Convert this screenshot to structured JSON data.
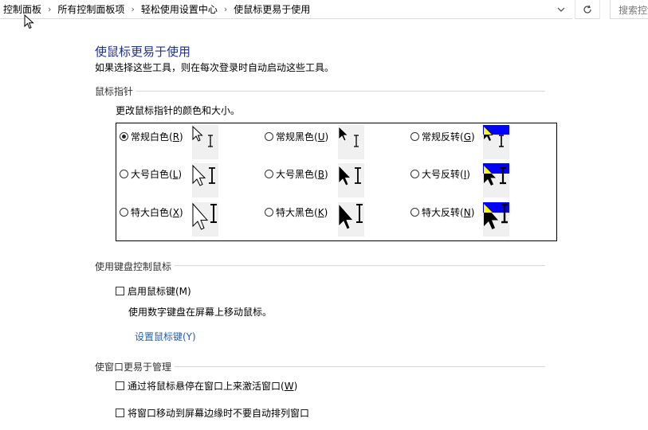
{
  "breadcrumb": [
    "控制面板",
    "所有控制面板项",
    "轻松使用设置中心",
    "使鼠标更易于使用"
  ],
  "separator": "›",
  "search_placeholder": "搜索控制面板",
  "page_title": "使鼠标更易于使用",
  "page_subtitle": "如果选择这些工具，则在每次登录时自动启动这些工具。",
  "pointer_section": {
    "header": "鼠标指针",
    "description": "更改鼠标指针的颜色和大小。",
    "schemes": [
      {
        "label": "常规白色",
        "key": "R",
        "checked": true,
        "style": "white",
        "size": "regular"
      },
      {
        "label": "常规黑色",
        "key": "U",
        "checked": false,
        "style": "black",
        "size": "regular"
      },
      {
        "label": "常规反转",
        "key": "G",
        "checked": false,
        "style": "inverted",
        "size": "regular"
      },
      {
        "label": "大号白色",
        "key": "L",
        "checked": false,
        "style": "white",
        "size": "large"
      },
      {
        "label": "大号黑色",
        "key": "B",
        "checked": false,
        "style": "black",
        "size": "large"
      },
      {
        "label": "大号反转",
        "key": "I",
        "checked": false,
        "style": "inverted",
        "size": "large"
      },
      {
        "label": "特大白色",
        "key": "X",
        "checked": false,
        "style": "white",
        "size": "xlarge"
      },
      {
        "label": "特大黑色",
        "key": "K",
        "checked": false,
        "style": "black",
        "size": "xlarge"
      },
      {
        "label": "特大反转",
        "key": "N",
        "checked": false,
        "style": "inverted",
        "size": "xlarge"
      }
    ]
  },
  "keyboard_section": {
    "header": "使用键盘控制鼠标",
    "mouse_keys_label": "启用鼠标键(M)",
    "mouse_keys_checked": false,
    "mouse_keys_desc": "使用数字键盘在屏幕上移动鼠标。",
    "setup_link": "设置鼠标键(Y)"
  },
  "window_section": {
    "header": "使窗口更易于管理",
    "hover_activate_prefix": "通过将鼠标悬停在窗口上来激活窗口(",
    "hover_activate_key": "W",
    "hover_activate_suffix": ")",
    "hover_activate_checked": false,
    "no_arrange_label": "将窗口移动到屏幕边缘时不要自动排列窗口",
    "no_arrange_checked": false
  },
  "colors": {
    "title": "#1e3287",
    "link": "#1f5fb0",
    "inverted_bg": "#0000ff",
    "inverted_accent": "#ffff00"
  }
}
